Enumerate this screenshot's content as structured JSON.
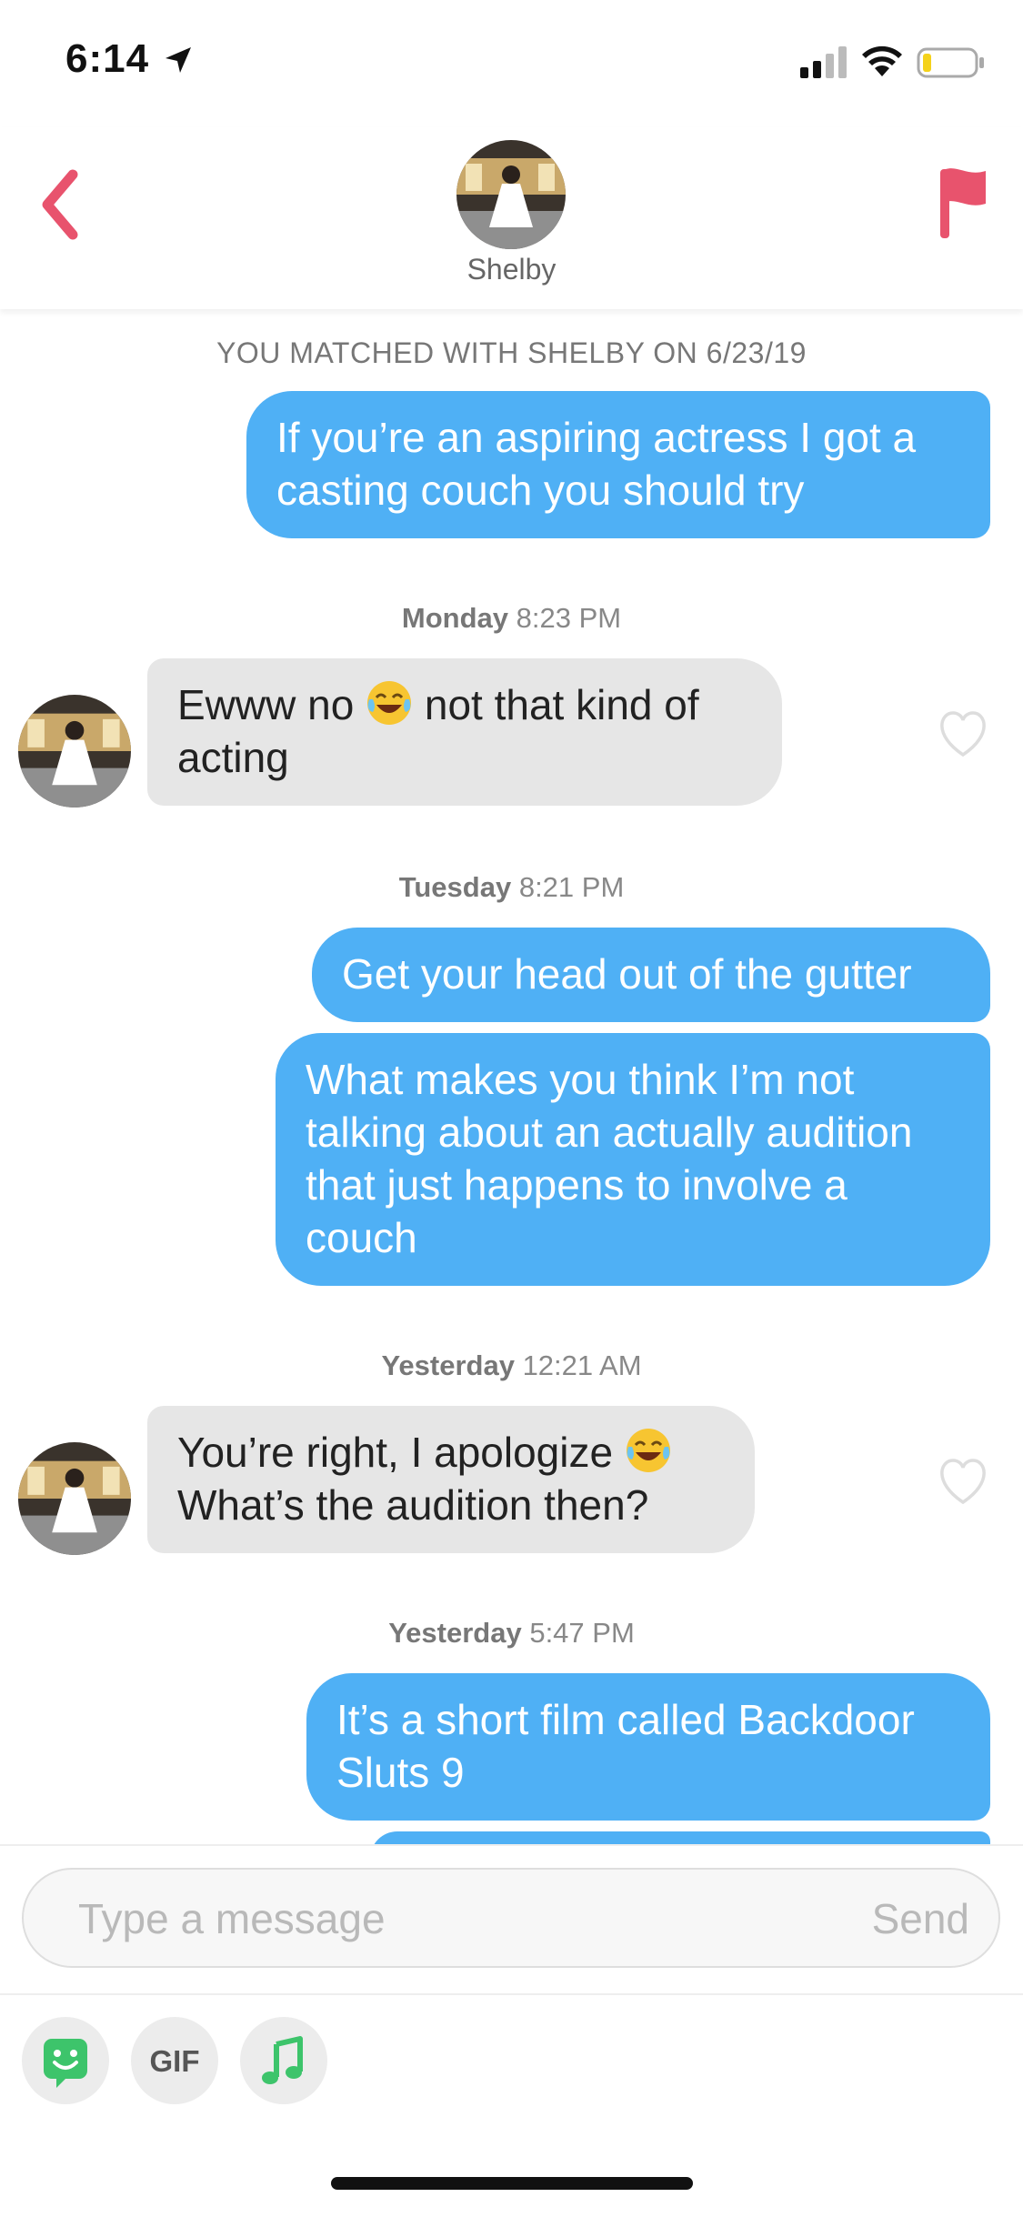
{
  "status_bar": {
    "time": "6:14"
  },
  "header": {
    "name": "Shelby"
  },
  "chat": {
    "match_notice": "YOU MATCHED WITH SHELBY ON 6/23/19",
    "timestamps": [
      {
        "day": "Monday",
        "time": "8:23 PM"
      },
      {
        "day": "Tuesday",
        "time": "8:21 PM"
      },
      {
        "day": "Yesterday",
        "time": "12:21 AM"
      },
      {
        "day": "Yesterday",
        "time": "5:47 PM"
      }
    ],
    "messages": [
      {
        "from": "me",
        "line1": "If you’re an aspiring actress I got a",
        "line2": "casting couch you should try"
      },
      {
        "from": "match",
        "text_a": "Ewww no",
        "emoji": "face-with-tears-of-joy",
        "text_b": "not that kind of",
        "line2": "acting"
      },
      {
        "from": "me",
        "text": "Get your head out of the gutter"
      },
      {
        "from": "me",
        "line1": "What makes you think I’m not",
        "line2": "talking about an actually audition",
        "line3": "that just happens to involve a",
        "line4": "couch"
      },
      {
        "from": "match",
        "text_a": "You’re right, I apologize",
        "emoji": "face-with-tears-of-joy",
        "line2": "What’s the audition then?"
      },
      {
        "from": "me",
        "line1": "It’s a short film called Backdoor",
        "line2": "Sluts 9"
      }
    ]
  },
  "composer": {
    "placeholder": "Type a message",
    "send_label": "Send",
    "tools": [
      {
        "icon": "sticker-icon"
      },
      {
        "label": "GIF"
      },
      {
        "icon": "music-note-icon"
      }
    ]
  },
  "colors": {
    "accent": "#e8536d",
    "outgoing_bubble": "#4fb0f5",
    "incoming_bubble": "#e6e6e6",
    "sticker_green": "#3dc46b"
  }
}
